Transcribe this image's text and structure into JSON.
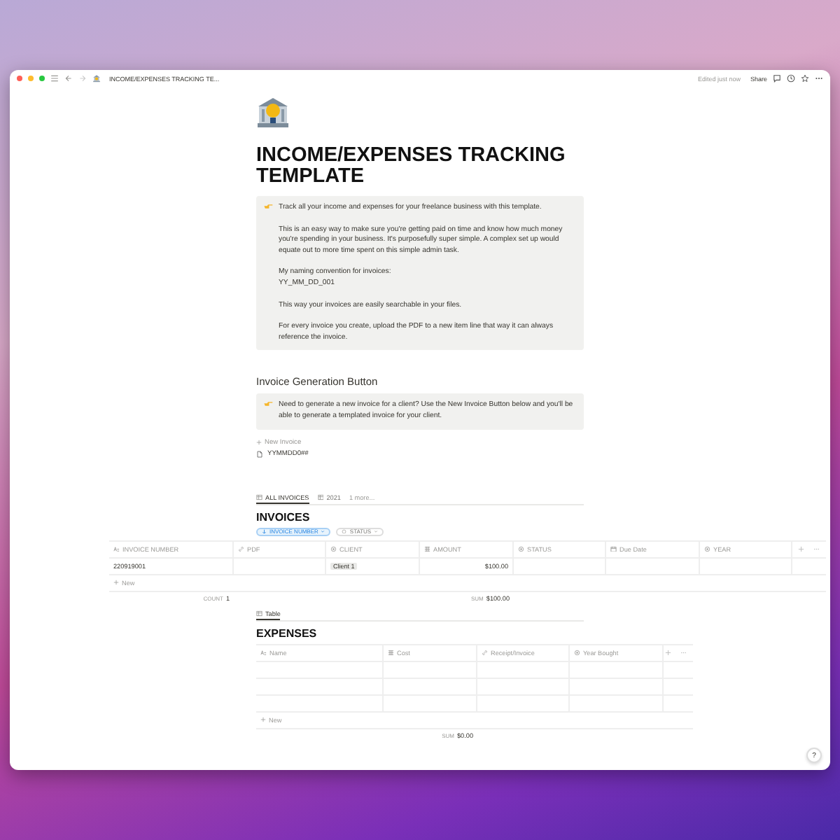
{
  "window": {
    "title": "INCOME/EXPENSES TRACKING TE...",
    "edited": "Edited just now",
    "share": "Share"
  },
  "page": {
    "title": "INCOME/EXPENSES TRACKING TEMPLATE",
    "callout": [
      "Track all your income and expenses for your freelance business with this template.",
      "This is an easy way to make sure you're getting paid on time and know how much money you're spending in your business. It's purposefully super simple. A complex set up would equate out to more time spent on this simple admin task.",
      "My naming convention for invoices:\nYY_MM_DD_001",
      "This way your invoices are easily searchable in your files.",
      "For every invoice you create, upload the PDF to a new item line that way it can always reference the invoice."
    ]
  },
  "invoice_section": {
    "heading": "Invoice Generation Button",
    "callout": "Need to generate a new invoice for a client? Use the New Invoice Button below and you'll be able to generate a templated invoice for your client.",
    "button": "New Invoice",
    "template": "YYMMDD0##"
  },
  "invoices": {
    "views": [
      {
        "label": "ALL INVOICES",
        "selected": true
      },
      {
        "label": "2021",
        "selected": false
      }
    ],
    "more": "1 more...",
    "title": "INVOICES",
    "filters": [
      {
        "label": "INVOICE NUMBER",
        "active": true
      },
      {
        "label": "STATUS",
        "active": false
      }
    ],
    "columns": [
      {
        "label": "INVOICE NUMBER",
        "kind": "text"
      },
      {
        "label": "PDF",
        "kind": "url"
      },
      {
        "label": "CLIENT",
        "kind": "select"
      },
      {
        "label": "AMOUNT",
        "kind": "number"
      },
      {
        "label": "STATUS",
        "kind": "select"
      },
      {
        "label": "Due Date",
        "kind": "date"
      },
      {
        "label": "YEAR",
        "kind": "select"
      }
    ],
    "rows": [
      [
        "220919001",
        "",
        "Client 1",
        "$100.00",
        "",
        "",
        ""
      ]
    ],
    "new_label": "New",
    "footer": {
      "count_label": "COUNT",
      "count": "1",
      "sum_label": "SUM",
      "sum": "$100.00"
    }
  },
  "expenses": {
    "views": [
      {
        "label": "Table",
        "selected": true
      }
    ],
    "title": "EXPENSES",
    "columns": [
      {
        "label": "Name",
        "kind": "text"
      },
      {
        "label": "Cost",
        "kind": "number"
      },
      {
        "label": "Receipt/Invoice",
        "kind": "url"
      },
      {
        "label": "Year Bought",
        "kind": "select"
      }
    ],
    "new_label": "New",
    "footer": {
      "sum_label": "SUM",
      "sum": "$0.00"
    }
  },
  "help": "?"
}
